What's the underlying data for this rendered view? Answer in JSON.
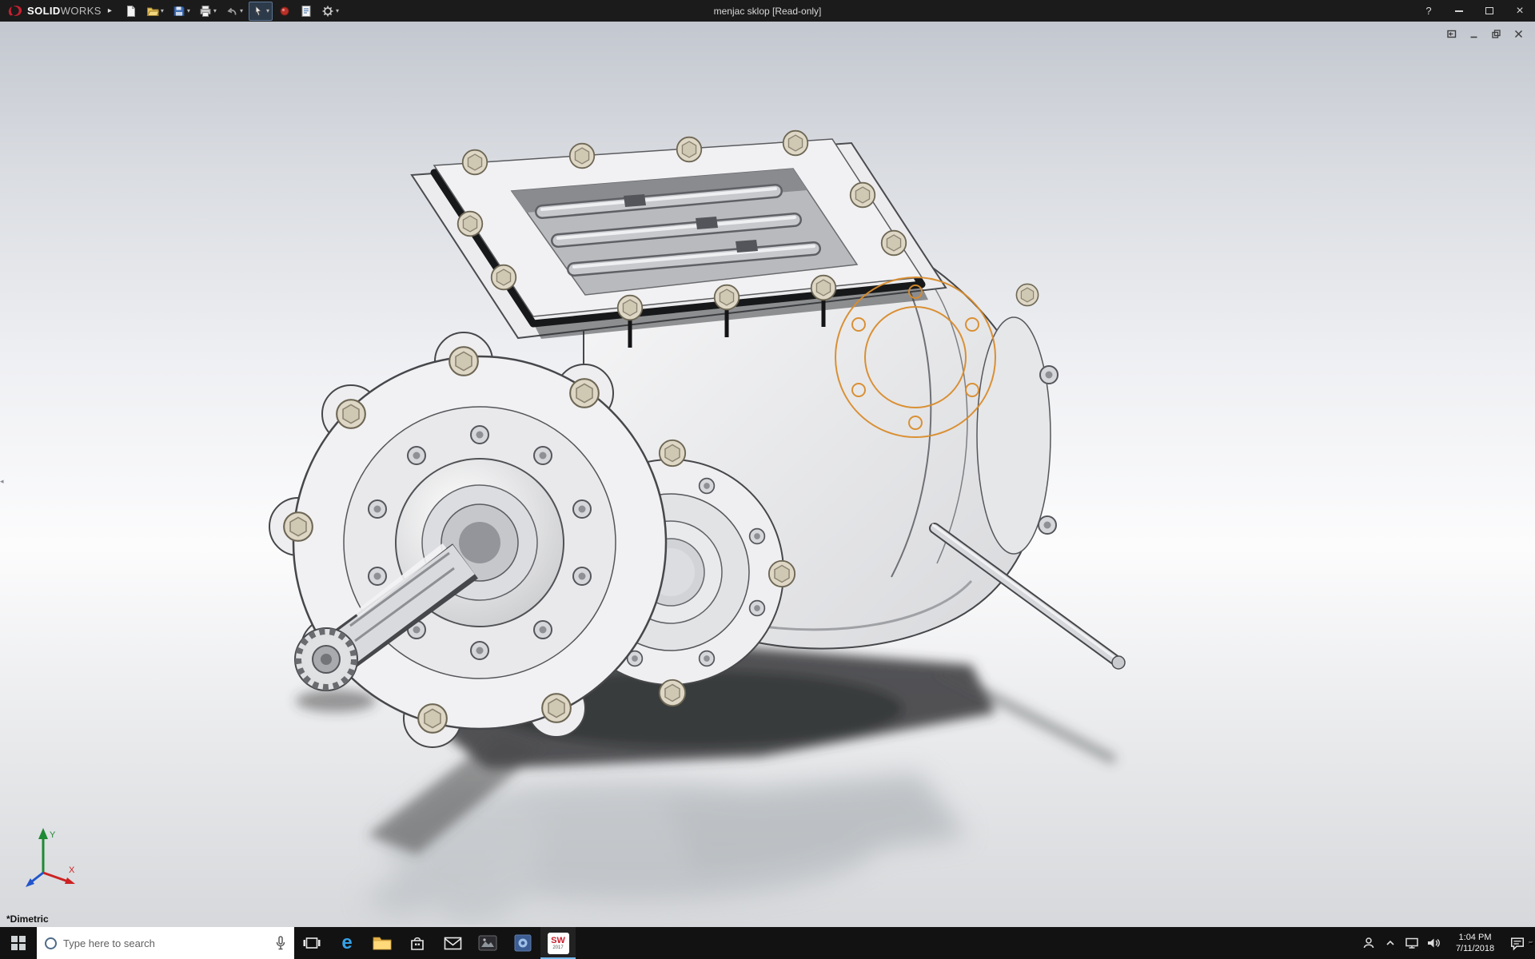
{
  "titlebar": {
    "brand_solid": "SOLID",
    "brand_works": "WORKS",
    "title": "menjac sklop [Read-only]",
    "toolbar_items": [
      "new-document",
      "open",
      "save",
      "print",
      "undo",
      "select",
      "rebuild",
      "file-properties",
      "options"
    ]
  },
  "icons": {
    "expand": "▸",
    "caret": "▾",
    "help": "?",
    "close": "×",
    "collapse_left": "◂",
    "edge_letter": "e"
  },
  "doc_window_controls": [
    "float",
    "minimize",
    "restore",
    "close"
  ],
  "viewport": {
    "view_label": "*Dimetric",
    "triad": {
      "x": "X",
      "y": "Y"
    }
  },
  "taskbar": {
    "search_placeholder": "Type here to search",
    "sw_badge": {
      "label": "SW",
      "year": "2017"
    },
    "clock": {
      "time": "1:04 PM",
      "date": "7/11/2018"
    },
    "apps": [
      "start",
      "search",
      "task-view",
      "edge",
      "file-explorer",
      "store",
      "mail",
      "movies-tv",
      "photos",
      "solidworks"
    ]
  },
  "colors": {
    "titlebar_bg": "#1b1b1b",
    "taskbar_bg": "#121212",
    "brand_red": "#c8202f",
    "selection_orange": "#d98c2b"
  }
}
